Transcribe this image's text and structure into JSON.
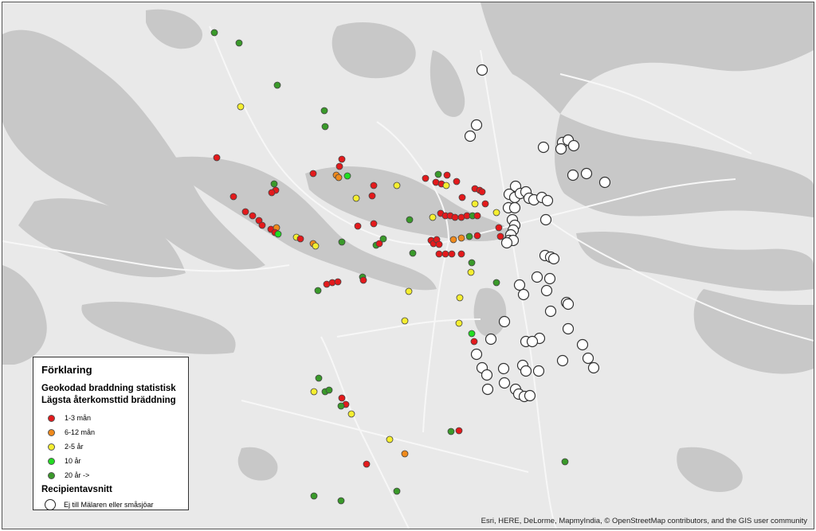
{
  "legend": {
    "title": "Förklaring",
    "layer_name": "Geokodad braddning statistisk",
    "sublayer": "Lägsta återkomsttid bräddning",
    "categories": [
      {
        "label": "1-3 mån",
        "color": "#e31a1c"
      },
      {
        "label": "6-12 mån",
        "color": "#f08a1c"
      },
      {
        "label": "2-5 år",
        "color": "#f5ee30"
      },
      {
        "label": "10 år",
        "color": "#22dd22"
      },
      {
        "label": "20 år ->",
        "color": "#3a9a2a"
      }
    ],
    "recipient_layer": "Recipientavsnitt",
    "recipient_label": "Ej till Mälaren eller småsjöar"
  },
  "attribution": "Esri, HERE, DeLorme, MapmyIndia, © OpenStreetMap contributors, and the GIS user community",
  "colors": {
    "water": "#c8c8c8",
    "land": "#e9e9e9",
    "road": "#f7f7f7",
    "outlet_stroke": "#333333"
  }
}
